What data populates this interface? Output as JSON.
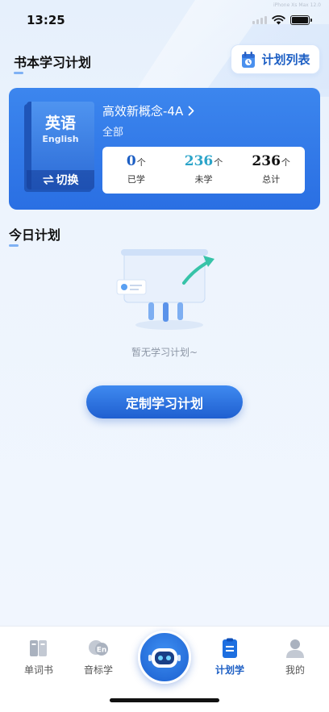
{
  "status_bar": {
    "time": "13:25",
    "watermark": "iPhone Xs Max 12.0"
  },
  "header": {
    "title": "书本学习计划",
    "plan_list_label": "计划列表"
  },
  "book": {
    "subject": "英语",
    "language": "English",
    "switch_label": "切换",
    "title": "高效新概念-4A",
    "scope": "全部",
    "stats": [
      {
        "value": "0",
        "unit": "个",
        "label": "已学",
        "color": "#1d5fc4"
      },
      {
        "value": "236",
        "unit": "个",
        "label": "未学",
        "color": "#2ba4c9"
      },
      {
        "value": "236",
        "unit": "个",
        "label": "总计",
        "color": "#111111"
      }
    ]
  },
  "today": {
    "title": "今日计划",
    "empty_text": "暂无学习计划~",
    "custom_button": "定制学习计划"
  },
  "tab_bar": {
    "tabs": [
      {
        "label": "单词书",
        "icon": "book-icon"
      },
      {
        "label": "音标学",
        "icon": "phonetics-icon"
      },
      {
        "label": "计划学",
        "icon": "clipboard-icon",
        "active": true
      },
      {
        "label": "我的",
        "icon": "user-icon"
      }
    ],
    "center_icon": "robot-icon"
  },
  "colors": {
    "accent": "#1d5fc4",
    "card": "#2f77e8"
  }
}
